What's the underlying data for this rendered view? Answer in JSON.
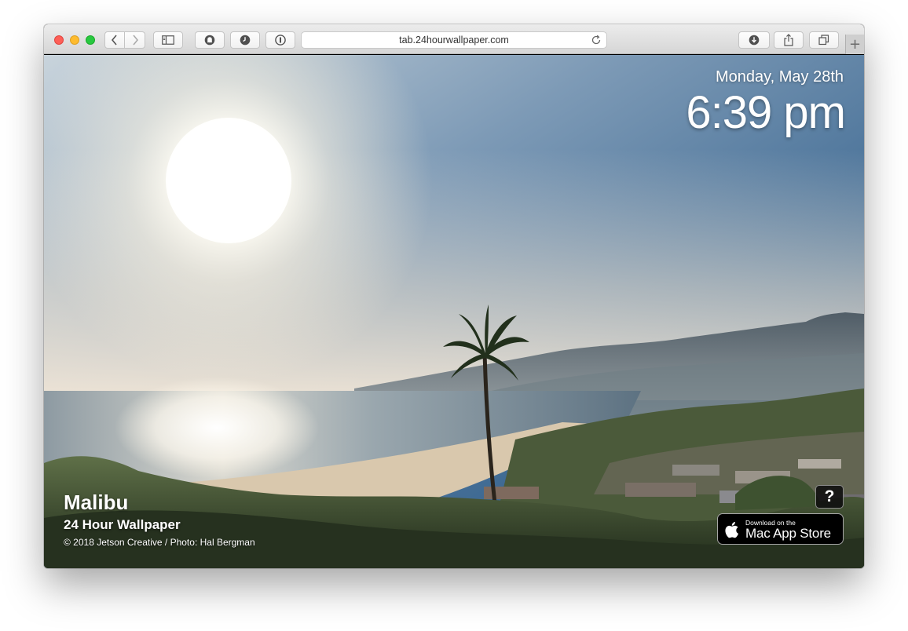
{
  "browser": {
    "url": "tab.24hourwallpaper.com",
    "new_tab_label": "+"
  },
  "clock": {
    "date": "Monday, May 28th",
    "time": "6:39 pm"
  },
  "wallpaper": {
    "location": "Malibu",
    "app_name": "24 Hour Wallpaper",
    "credit": "© 2018 Jetson Creative / Photo: Hal Bergman"
  },
  "help": {
    "label": "?"
  },
  "app_store": {
    "small_label": "Download on the",
    "big_label": "Mac App Store"
  },
  "colors": {
    "traffic_red": "#fd5f57",
    "traffic_yellow": "#febb2e",
    "traffic_green": "#28c840",
    "sky_top": "#1e3a63",
    "sun": "#fffdf5"
  },
  "icons": [
    "back-icon",
    "forward-icon",
    "sidebar-icon",
    "ghostery-icon",
    "history-clock-icon",
    "onepassword-icon",
    "reload-icon",
    "download-icon",
    "share-icon",
    "tabs-overview-icon",
    "apple-logo-icon"
  ]
}
